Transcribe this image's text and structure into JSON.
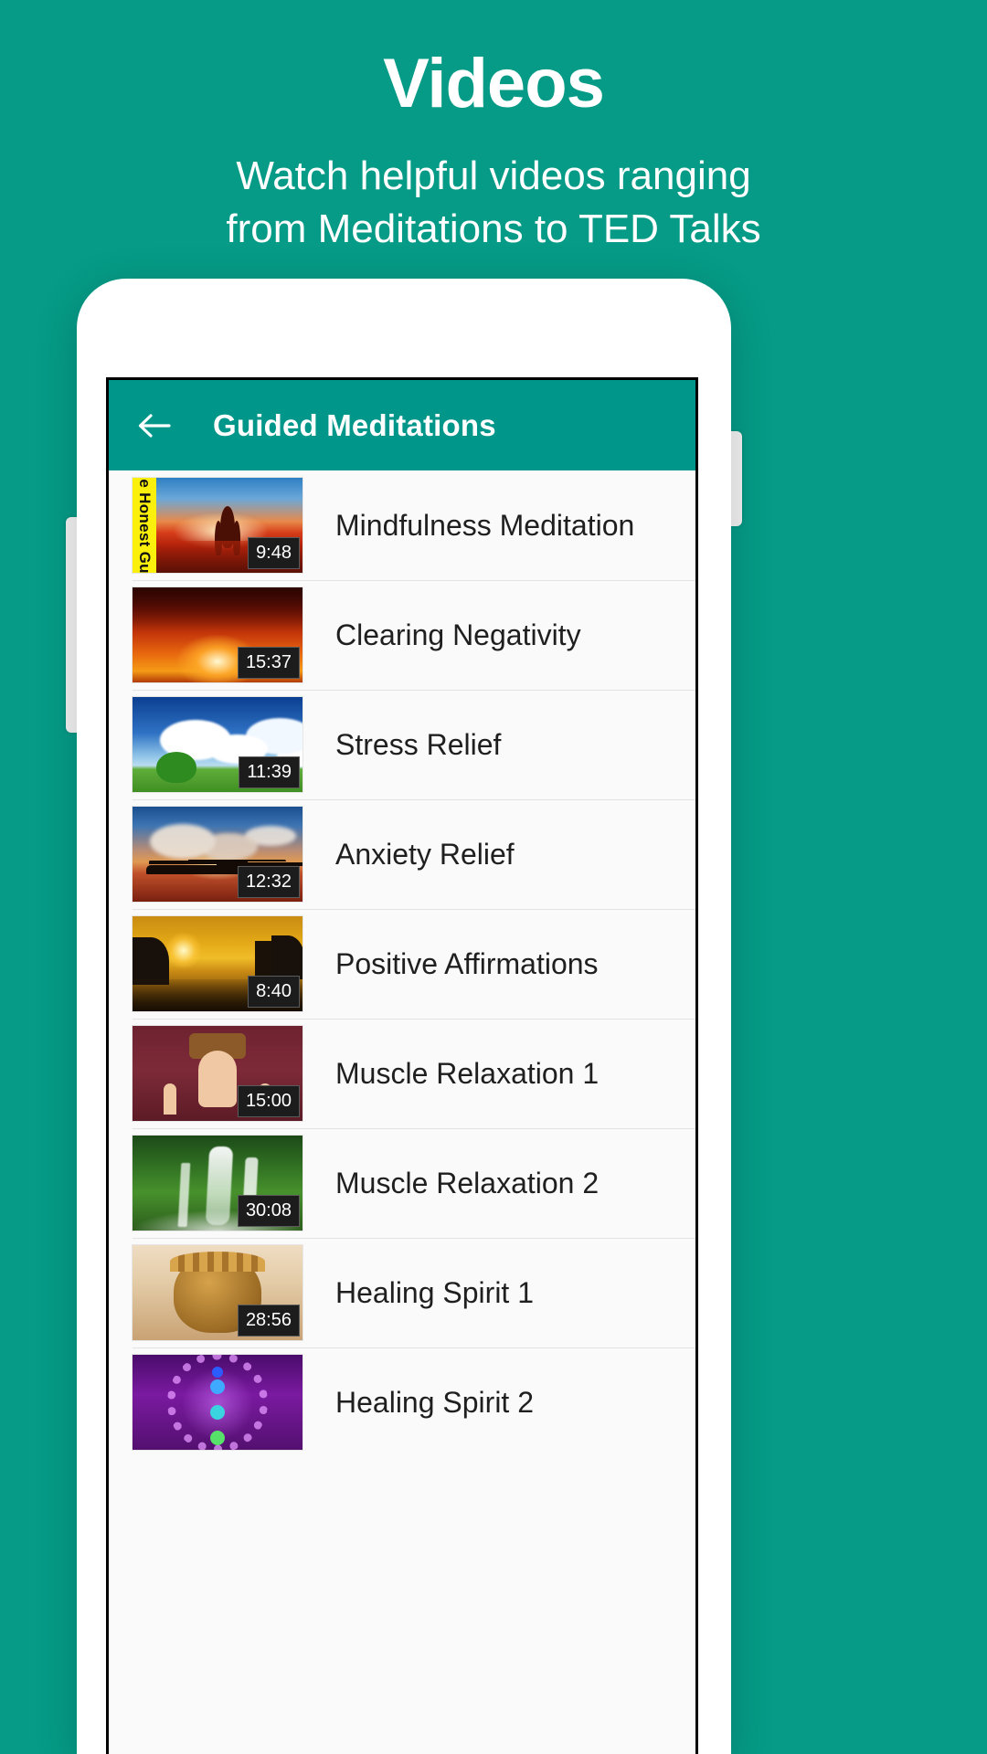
{
  "promo": {
    "title": "Videos",
    "subtitle_line1": "Watch helpful videos ranging",
    "subtitle_line2": "from Meditations to TED Talks"
  },
  "colors": {
    "background": "#059b86",
    "appbar": "#00968a",
    "app_background": "#fafafa",
    "badge": "#1c1c1c",
    "brand_bar": "#fbf00b"
  },
  "app": {
    "appbar": {
      "back_icon": "arrow-left-icon",
      "title": "Guided Meditations"
    },
    "videos": [
      {
        "title": "Mindfulness Meditation",
        "duration": "9:48",
        "brand_label": "The Honest Guys",
        "thumb_style": "art-sunset-yoga"
      },
      {
        "title": "Clearing Negativity",
        "duration": "15:37",
        "brand_label": "",
        "thumb_style": "art-red-sunset"
      },
      {
        "title": "Stress Relief",
        "duration": "11:39",
        "brand_label": "",
        "thumb_style": "art-tree-sky"
      },
      {
        "title": "Anxiety Relief",
        "duration": "12:32",
        "brand_label": "",
        "thumb_style": "art-island"
      },
      {
        "title": "Positive Affirmations",
        "duration": "8:40",
        "brand_label": "",
        "thumb_style": "art-golden-lake"
      },
      {
        "title": "Muscle Relaxation 1",
        "duration": "15:00",
        "brand_label": "",
        "thumb_style": "art-bedroom"
      },
      {
        "title": "Muscle Relaxation 2",
        "duration": "30:08",
        "brand_label": "",
        "thumb_style": "art-waterfall"
      },
      {
        "title": "Healing Spirit 1",
        "duration": "28:56",
        "brand_label": "",
        "thumb_style": "art-buddha"
      },
      {
        "title": "Healing Spirit 2",
        "duration": "",
        "brand_label": "",
        "thumb_style": "art-chakra"
      }
    ]
  },
  "device": {
    "camera_icon": "front-camera-icon",
    "speaker_icon": "earpiece-speaker-icon",
    "volume_button": "volume-button",
    "power_button": "power-button"
  }
}
